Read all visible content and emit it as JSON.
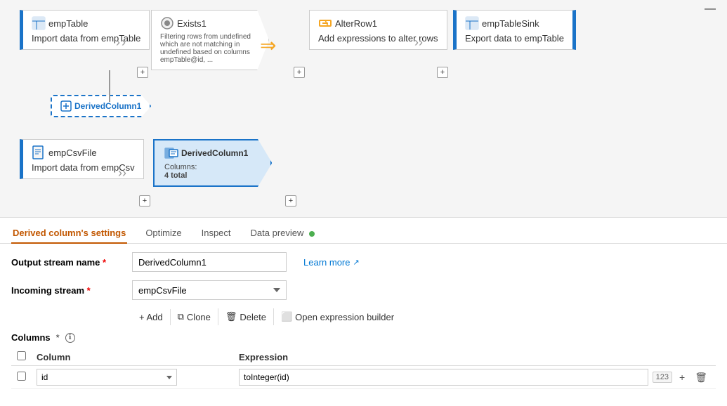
{
  "canvas": {
    "nodes": {
      "empTable": {
        "title": "empTable",
        "desc": "Import data from empTable",
        "icon": "table-icon"
      },
      "exists1": {
        "title": "Exists1",
        "desc": "Filtering rows from undefined which are not matching in undefined based on columns empTable@id, ...",
        "icon": "filter-icon"
      },
      "alterRow1": {
        "title": "AlterRow1",
        "desc": "Add expressions to alter rows",
        "icon": "alter-icon"
      },
      "empTableSink": {
        "title": "empTableSink",
        "desc": "Export data to empTable",
        "icon": "sink-icon"
      },
      "derivedColumn1_dashed": {
        "title": "DerivedColumn1",
        "icon": "derived-icon"
      },
      "empCsvFile": {
        "title": "empCsvFile",
        "desc": "Import data from empCsv",
        "icon": "csv-icon"
      },
      "derivedColumn1_active": {
        "title": "DerivedColumn1",
        "desc_label": "Columns:",
        "desc_value": "4 total",
        "icon": "derived-icon"
      }
    },
    "plusLabels": [
      "+",
      "+",
      "+",
      "+",
      "+"
    ]
  },
  "tabs": [
    {
      "label": "Derived column's settings",
      "id": "settings",
      "active": true
    },
    {
      "label": "Optimize",
      "id": "optimize",
      "active": false
    },
    {
      "label": "Inspect",
      "id": "inspect",
      "active": false
    },
    {
      "label": "Data preview",
      "id": "preview",
      "active": false,
      "indicator": true
    }
  ],
  "form": {
    "output_stream_label": "Output stream name",
    "output_stream_required": "*",
    "output_stream_value": "DerivedColumn1",
    "incoming_stream_label": "Incoming stream",
    "incoming_stream_required": "*",
    "incoming_stream_value": "empCsvFile",
    "incoming_stream_placeholder": "empCsvFile",
    "learn_more_text": "Learn more",
    "learn_more_icon": "↗"
  },
  "toolbar": {
    "add_label": "+ Add",
    "clone_label": "Clone",
    "delete_label": "Delete",
    "expression_builder_label": "Open expression builder",
    "clone_icon": "⧉",
    "delete_icon": "🗑",
    "expression_icon": "⬜"
  },
  "columns_section": {
    "label": "Columns",
    "required": "*",
    "info_icon": "ℹ",
    "header_column": "Column",
    "header_expression": "Expression",
    "rows": [
      {
        "column_name": "id",
        "expression": "toInteger(id)",
        "type_badge": "123"
      }
    ]
  },
  "colors": {
    "accent_blue": "#1a73c8",
    "accent_orange": "#c25700",
    "active_tab_color": "#c25700",
    "indicator_green": "#4caf50"
  }
}
